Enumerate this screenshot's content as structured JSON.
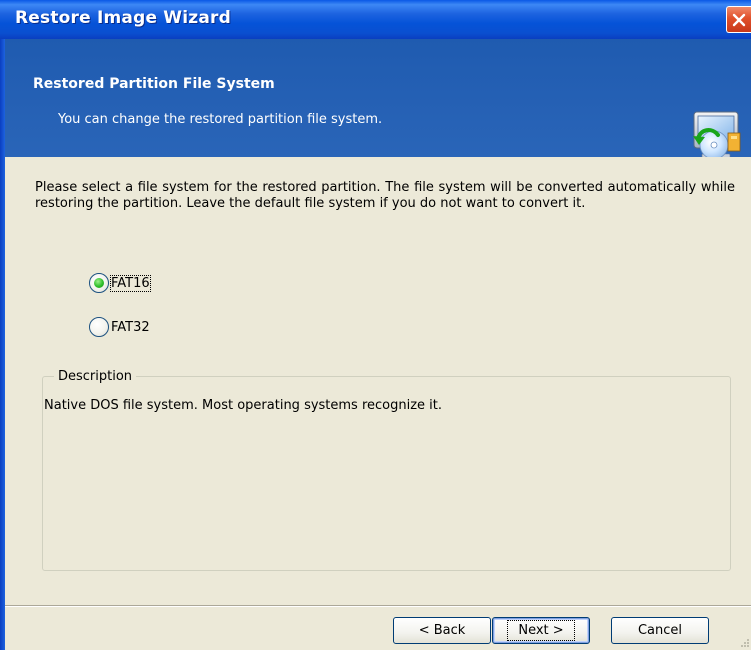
{
  "window": {
    "title": "Restore Image Wizard"
  },
  "header": {
    "title": "Restored Partition File System",
    "subtitle": "You can change the restored partition file system."
  },
  "main": {
    "instructions": "Please select a file system for the restored partition. The file system will be converted automatically while restoring the partition. Leave the default file system if you do not want to convert it.",
    "options": [
      {
        "label": "FAT16",
        "checked": true
      },
      {
        "label": "FAT32",
        "checked": false
      }
    ],
    "description": {
      "legend": "Description",
      "text": "Native DOS file system. Most operating systems recognize it."
    }
  },
  "footer": {
    "back_label": "< Back",
    "next_label": "Next >",
    "cancel_label": "Cancel"
  },
  "icons": {
    "close": "close-icon",
    "wizard": "restore-wizard-icon"
  },
  "colors": {
    "titlebar": "#0553d8",
    "header": "#2a65b8",
    "dialog_bg": "#ece9d8",
    "close_button": "#e0502a",
    "radio_selected": "#2fbf2a"
  }
}
